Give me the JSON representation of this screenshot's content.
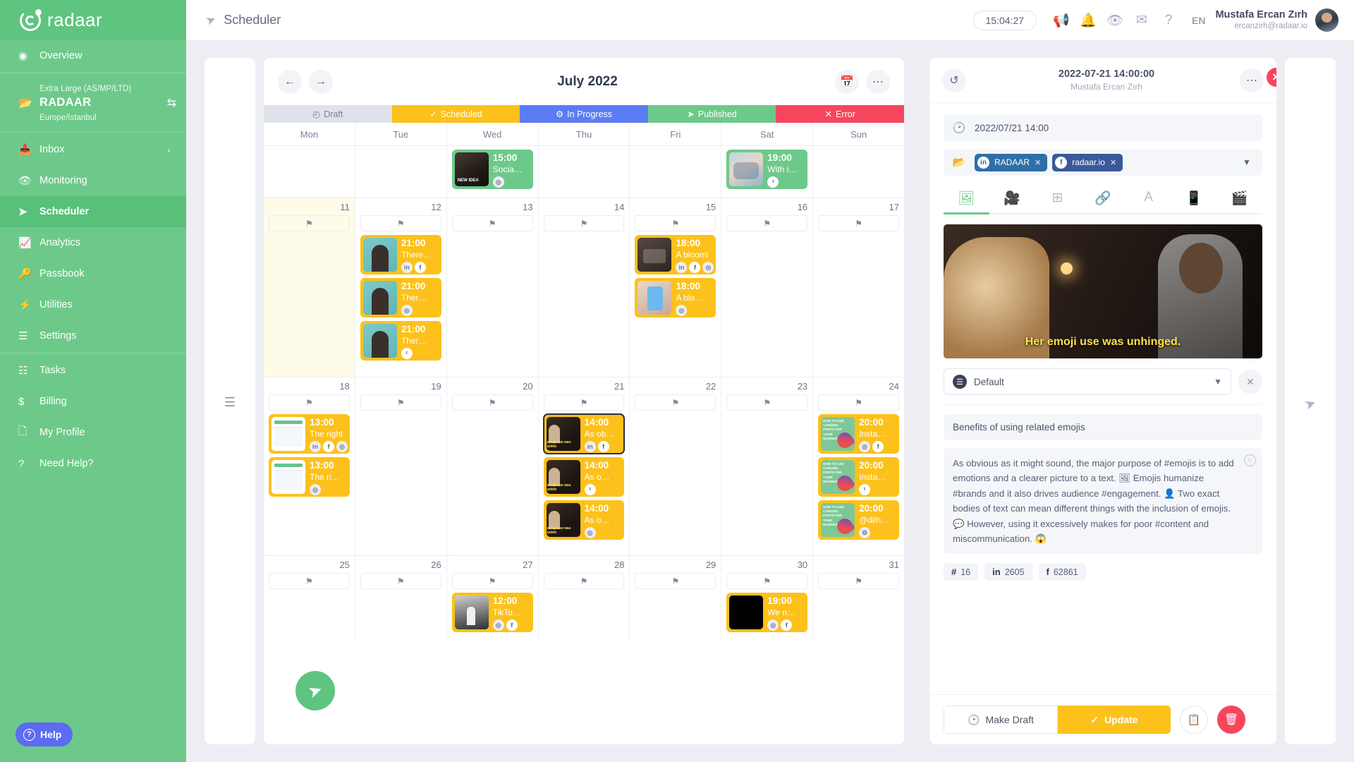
{
  "brand": {
    "name": "radaar"
  },
  "sidebar": {
    "items": [
      {
        "label": "Overview",
        "icon": "speedometer-icon",
        "active": false
      },
      {
        "label": "Inbox",
        "icon": "inbox-icon",
        "active": false,
        "chevron": "‹"
      },
      {
        "label": "Monitoring",
        "icon": "eye-icon",
        "active": false
      },
      {
        "label": "Scheduler",
        "icon": "paper-plane-icon",
        "active": true
      },
      {
        "label": "Analytics",
        "icon": "chart-line-icon",
        "active": false
      },
      {
        "label": "Passbook",
        "icon": "key-icon",
        "active": false
      },
      {
        "label": "Utilities",
        "icon": "bolt-icon",
        "active": false
      },
      {
        "label": "Settings",
        "icon": "sliders-icon",
        "active": false
      },
      {
        "label": "Tasks",
        "icon": "list-icon",
        "active": false
      },
      {
        "label": "Billing",
        "icon": "dollar-icon",
        "active": false
      },
      {
        "label": "My Profile",
        "icon": "id-card-icon",
        "active": false
      },
      {
        "label": "Need Help?",
        "icon": "question-icon",
        "active": false
      }
    ],
    "workspace": {
      "plan": "Extra Large (AS/MP/LTD)",
      "name": "RADAAR",
      "timezone": "Europe/Istanbul"
    },
    "help_button": "Help"
  },
  "topbar": {
    "page_title": "Scheduler",
    "clock": "15:04:27",
    "language": "EN",
    "user_name": "Mustafa Ercan Zırh",
    "user_email": "ercanzirh@radaar.io",
    "icons": [
      "megaphone-icon",
      "bell-icon",
      "eye-icon",
      "envelope-icon",
      "question-icon"
    ]
  },
  "calendar": {
    "title": "July 2022",
    "statuses": [
      {
        "label": "Draft",
        "icon": "◴",
        "color": "#dfe2ea",
        "text": "#7b8197"
      },
      {
        "label": "Scheduled",
        "icon": "✓",
        "color": "#fcc11b",
        "text": "#ffffff"
      },
      {
        "label": "In Progress",
        "icon": "⚙",
        "color": "#5c7cf5",
        "text": "#ffffff"
      },
      {
        "label": "Published",
        "icon": "➤",
        "color": "#6dc98a",
        "text": "#ffffff"
      },
      {
        "label": "Error",
        "icon": "✕",
        "color": "#f6465d",
        "text": "#ffffff"
      }
    ],
    "days_of_week": [
      "Mon",
      "Tue",
      "Wed",
      "Thu",
      "Fri",
      "Sat",
      "Sun"
    ],
    "weeks": [
      {
        "height_class": "r0",
        "days": [
          {
            "num": "",
            "events": []
          },
          {
            "num": "",
            "events": []
          },
          {
            "num": "",
            "events": [
              {
                "time": "15:00",
                "title": "Socia…",
                "color": "green",
                "thumb": "th-newidea",
                "socials": [
                  "instagram"
                ]
              }
            ]
          },
          {
            "num": "",
            "events": []
          },
          {
            "num": "",
            "events": []
          },
          {
            "num": "",
            "events": [
              {
                "time": "19:00",
                "title": "With i…",
                "color": "green",
                "thumb": "th-friends",
                "socials": [
                  "twitter"
                ]
              }
            ]
          },
          {
            "num": "",
            "events": []
          }
        ]
      },
      {
        "height_class": "r1",
        "days": [
          {
            "num": "11",
            "today": true,
            "events": []
          },
          {
            "num": "12",
            "events": [
              {
                "time": "21:00",
                "title": "There…",
                "color": "yellow",
                "thumb": "th-girl",
                "socials": [
                  "linkedin",
                  "facebook"
                ]
              },
              {
                "time": "21:00",
                "title": "Ther…",
                "color": "yellow",
                "thumb": "th-girl",
                "socials": [
                  "instagram"
                ]
              },
              {
                "time": "21:00",
                "title": "Ther…",
                "color": "yellow",
                "thumb": "th-girl",
                "socials": [
                  "twitter"
                ]
              }
            ]
          },
          {
            "num": "13",
            "events": []
          },
          {
            "num": "14",
            "events": []
          },
          {
            "num": "15",
            "events": [
              {
                "time": "18:00",
                "title": "A bloomi",
                "color": "yellow",
                "thumb": "th-desk",
                "socials": [
                  "linkedin",
                  "facebook",
                  "instagram"
                ]
              },
              {
                "time": "18:00",
                "title": "A blo…",
                "color": "yellow",
                "thumb": "th-phone",
                "socials": [
                  "instagram"
                ]
              }
            ]
          },
          {
            "num": "16",
            "events": []
          },
          {
            "num": "17",
            "events": []
          }
        ]
      },
      {
        "height_class": "r2",
        "days": [
          {
            "num": "18",
            "events": [
              {
                "time": "13:00",
                "title": "The right",
                "color": "yellow",
                "thumb": "th-dash",
                "socials": [
                  "linkedin",
                  "facebook",
                  "instagram"
                ]
              },
              {
                "time": "13:00",
                "title": "The ri…",
                "color": "yellow",
                "thumb": "th-dash",
                "socials": [
                  "instagram"
                ]
              }
            ]
          },
          {
            "num": "19",
            "events": []
          },
          {
            "num": "20",
            "events": []
          },
          {
            "num": "21",
            "events": [
              {
                "time": "14:00",
                "title": "As ob…",
                "color": "yellow",
                "thumb": "th-emoji",
                "socials": [
                  "linkedin",
                  "facebook"
                ],
                "selected": true
              },
              {
                "time": "14:00",
                "title": "As o…",
                "color": "yellow",
                "thumb": "th-emoji",
                "socials": [
                  "twitter"
                ]
              },
              {
                "time": "14:00",
                "title": "As o…",
                "color": "yellow",
                "thumb": "th-emoji",
                "socials": [
                  "instagram"
                ]
              }
            ]
          },
          {
            "num": "22",
            "events": []
          },
          {
            "num": "23",
            "events": []
          },
          {
            "num": "24",
            "events": [
              {
                "time": "20:00",
                "title": "Insta…",
                "color": "yellow",
                "thumb": "th-rocket",
                "socials": [
                  "instagram",
                  "facebook"
                ]
              },
              {
                "time": "20:00",
                "title": "Insta…",
                "color": "yellow",
                "thumb": "th-rocket",
                "socials": [
                  "twitter"
                ]
              },
              {
                "time": "20:00",
                "title": "@dilh…",
                "color": "yellow",
                "thumb": "th-rocket",
                "socials": [
                  "gear"
                ]
              }
            ]
          }
        ]
      },
      {
        "height_class": "r4",
        "days": [
          {
            "num": "25",
            "events": []
          },
          {
            "num": "26",
            "events": []
          },
          {
            "num": "27",
            "events": [
              {
                "time": "12:00",
                "title": "TikTo…",
                "color": "yellow",
                "thumb": "th-tiktok",
                "socials": [
                  "instagram",
                  "facebook"
                ]
              }
            ]
          },
          {
            "num": "28",
            "events": []
          },
          {
            "num": "29",
            "events": []
          },
          {
            "num": "30",
            "events": [
              {
                "time": "19:00",
                "title": "We n…",
                "color": "yellow",
                "thumb": "th-black",
                "socials": [
                  "instagram",
                  "facebook"
                ]
              }
            ]
          },
          {
            "num": "31",
            "events": []
          }
        ]
      }
    ]
  },
  "detail": {
    "header_title": "2022-07-21 14:00:00",
    "header_subtitle": "Mustafa Ercan Zırh",
    "datetime_value": "2022/07/21 14:00",
    "accounts": [
      {
        "network": "linkedin",
        "name": "RADAAR"
      },
      {
        "network": "facebook",
        "name": "radaar.io"
      }
    ],
    "tabs": [
      {
        "icon": "image-icon",
        "active": true
      },
      {
        "icon": "video-icon",
        "active": false
      },
      {
        "icon": "grid-icon",
        "active": false
      },
      {
        "icon": "link-icon",
        "active": false
      },
      {
        "icon": "text-icon",
        "active": false
      },
      {
        "icon": "mobile-icon",
        "active": false
      },
      {
        "icon": "clapperboard-icon",
        "active": false
      }
    ],
    "preview_caption": "Her emoji use was unhinged.",
    "profile_label": "Default",
    "post_title": "Benefits of using related emojis",
    "post_body": "As obvious as it might sound, the major purpose of #emojis is to add emotions and a clearer picture to a text. 🖼 Emojis humanize #brands and it also drives audience #engagement. 👤 Two exact bodies of text can mean different things with the inclusion of emojis. 💬 However, using it excessively makes for poor #content and miscommunication. 😱",
    "stats": [
      {
        "icon": "#",
        "value": "16"
      },
      {
        "icon": "in",
        "value": "2605"
      },
      {
        "icon": "f",
        "value": "62861"
      }
    ],
    "make_draft_label": "Make Draft",
    "update_label": "Update"
  },
  "colors": {
    "brand_green": "#6dc98a",
    "yellow": "#fcc11b",
    "blue": "#5c7cf5",
    "red": "#f6465d"
  }
}
